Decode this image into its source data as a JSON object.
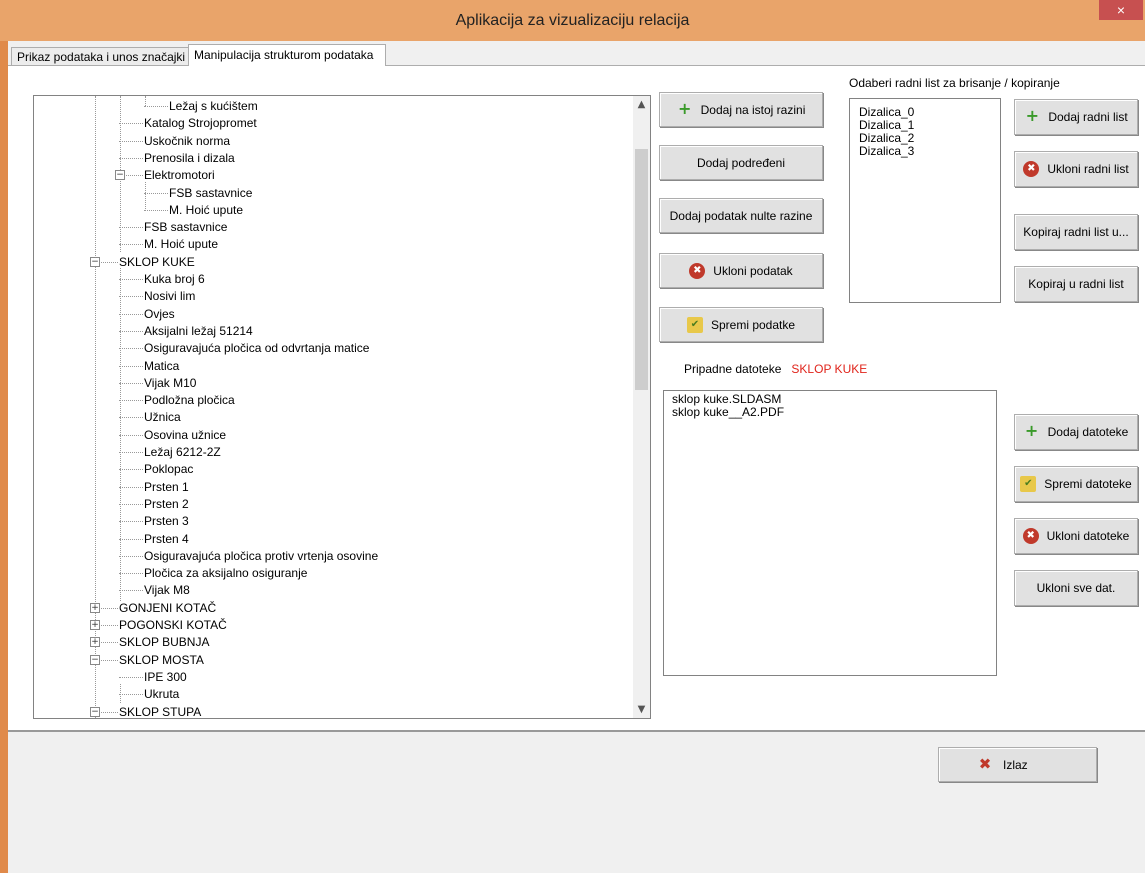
{
  "window": {
    "title": "Aplikacija za vizualizaciju relacija",
    "close": "×"
  },
  "tabs": [
    "Prikaz podataka i unos značajki",
    "Manipulacija strukturom podataka"
  ],
  "tree": {
    "nodes": [
      {
        "label": "Ležaj s kućištem",
        "level": 3,
        "toggle": ""
      },
      {
        "label": "Katalog Strojopromet",
        "level": 2,
        "toggle": ""
      },
      {
        "label": "Uskočnik norma",
        "level": 2,
        "toggle": ""
      },
      {
        "label": "Prenosila i dizala",
        "level": 2,
        "toggle": ""
      },
      {
        "label": "Elektromotori",
        "level": 2,
        "toggle": "−"
      },
      {
        "label": "FSB sastavnice",
        "level": 3,
        "toggle": ""
      },
      {
        "label": "M. Hoić upute",
        "level": 3,
        "toggle": ""
      },
      {
        "label": "FSB sastavnice",
        "level": 2,
        "toggle": ""
      },
      {
        "label": "M. Hoić upute",
        "level": 2,
        "toggle": ""
      },
      {
        "label": "SKLOP KUKE",
        "level": 1,
        "toggle": "−"
      },
      {
        "label": "Kuka broj 6",
        "level": 2,
        "toggle": ""
      },
      {
        "label": "Nosivi lim",
        "level": 2,
        "toggle": ""
      },
      {
        "label": "Ovjes",
        "level": 2,
        "toggle": ""
      },
      {
        "label": "Aksijalni ležaj 51214",
        "level": 2,
        "toggle": ""
      },
      {
        "label": "Osiguravajuća pločica od odvrtanja matice",
        "level": 2,
        "toggle": ""
      },
      {
        "label": "Matica",
        "level": 2,
        "toggle": ""
      },
      {
        "label": "Vijak M10",
        "level": 2,
        "toggle": ""
      },
      {
        "label": "Podložna pločica",
        "level": 2,
        "toggle": ""
      },
      {
        "label": "Užnica",
        "level": 2,
        "toggle": ""
      },
      {
        "label": "Osovina užnice",
        "level": 2,
        "toggle": ""
      },
      {
        "label": "Ležaj 6212-2Z",
        "level": 2,
        "toggle": ""
      },
      {
        "label": "Poklopac",
        "level": 2,
        "toggle": ""
      },
      {
        "label": "Prsten 1",
        "level": 2,
        "toggle": ""
      },
      {
        "label": "Prsten 2",
        "level": 2,
        "toggle": ""
      },
      {
        "label": "Prsten 3",
        "level": 2,
        "toggle": ""
      },
      {
        "label": "Prsten 4",
        "level": 2,
        "toggle": ""
      },
      {
        "label": "Osiguravajuća pločica protiv vrtenja osovine",
        "level": 2,
        "toggle": ""
      },
      {
        "label": "Pločica za aksijalno osiguranje",
        "level": 2,
        "toggle": ""
      },
      {
        "label": "Vijak M8",
        "level": 2,
        "toggle": ""
      },
      {
        "label": "GONJENI KOTAČ",
        "level": 1,
        "toggle": "+"
      },
      {
        "label": "POGONSKI KOTAČ",
        "level": 1,
        "toggle": "+"
      },
      {
        "label": "SKLOP BUBNJA",
        "level": 1,
        "toggle": "+"
      },
      {
        "label": "SKLOP MOSTA",
        "level": 1,
        "toggle": "−"
      },
      {
        "label": "IPE 300",
        "level": 2,
        "toggle": ""
      },
      {
        "label": "Ukruta",
        "level": 2,
        "toggle": ""
      },
      {
        "label": "SKLOP STUPA",
        "level": 1,
        "toggle": "−"
      }
    ]
  },
  "actions": {
    "add_same_level": "Dodaj na istoj razini",
    "add_child": "Dodaj podređeni",
    "add_root": "Dodaj podatak nulte razine",
    "remove_item": "Ukloni podatak",
    "save_items": "Spremi podatke"
  },
  "worksheets": {
    "label": "Odaberi radni list za brisanje / kopiranje",
    "items": [
      "Dizalica_0",
      "Dizalica_1",
      "Dizalica_2",
      "Dizalica_3"
    ],
    "add": "Dodaj radni list",
    "remove": "Ukloni radni list",
    "copy_to": "Kopiraj radni list u...",
    "copy_into": "Kopiraj u radni list"
  },
  "files": {
    "label": "Pripadne datoteke",
    "selected_item": "SKLOP KUKE",
    "items": [
      "sklop kuke.SLDASM",
      "sklop kuke__A2.PDF"
    ],
    "add": "Dodaj datoteke",
    "save": "Spremi datoteke",
    "remove": "Ukloni datoteke",
    "remove_all": "Ukloni sve dat."
  },
  "footer": {
    "exit": "Izlaz"
  },
  "icons": {
    "add": "plus-icon",
    "remove": "remove-icon",
    "save": "save-icon",
    "exit": "exit-icon"
  },
  "colors": {
    "titlebar": "#e9a46a",
    "close": "#c75050",
    "highlight": "#e0241b"
  }
}
